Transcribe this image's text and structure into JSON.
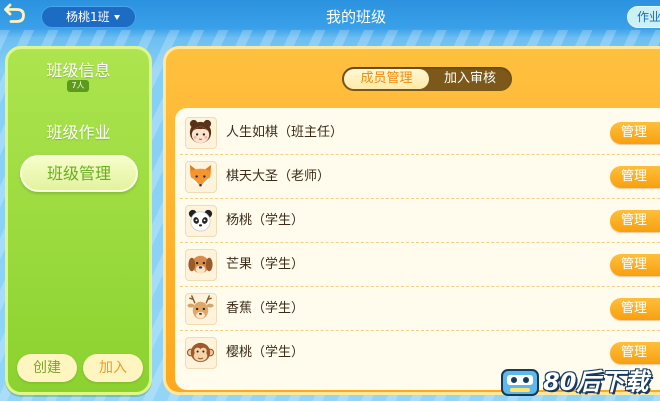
{
  "topbar": {
    "back_icon": "back-arrow-icon",
    "class_selector": {
      "label": "杨桃1班",
      "icon": "caret-down-icon"
    },
    "title": "我的班级",
    "homework_button": "作业"
  },
  "sidebar": {
    "items": [
      {
        "label": "班级信息",
        "badge": "7人",
        "selected": false
      },
      {
        "label": "班级作业",
        "selected": false
      },
      {
        "label": "班级管理",
        "selected": true
      }
    ],
    "create_label": "创建",
    "join_label": "加入"
  },
  "main": {
    "tabs": [
      {
        "label": "成员管理",
        "selected": true
      },
      {
        "label": "加入审核",
        "selected": false
      }
    ],
    "members": [
      {
        "name": "人生如棋（班主任）",
        "avatar": "girl-avatar-icon",
        "action": "管理"
      },
      {
        "name": "棋天大圣（老师）",
        "avatar": "fox-avatar-icon",
        "action": "管理"
      },
      {
        "name": "杨桃（学生）",
        "avatar": "panda-avatar-icon",
        "action": "管理"
      },
      {
        "name": "芒果（学生）",
        "avatar": "dog-avatar-icon",
        "action": "管理"
      },
      {
        "name": "香蕉（学生）",
        "avatar": "deer-avatar-icon",
        "action": "管理"
      },
      {
        "name": "樱桃（学生）",
        "avatar": "monkey-avatar-icon",
        "action": "管理"
      }
    ]
  },
  "watermark": {
    "text": "80后下载",
    "logo_icon": "logo-icon"
  },
  "colors": {
    "topbar_blue": "#2b92df",
    "sidebar_green": "#8bd22f",
    "selected_item_text": "#69ad21",
    "panel_orange": "#ffa71f",
    "button_orange": "#f7a010",
    "tab_selected_text": "#f08a0c",
    "tab_track": "#7c581b"
  }
}
